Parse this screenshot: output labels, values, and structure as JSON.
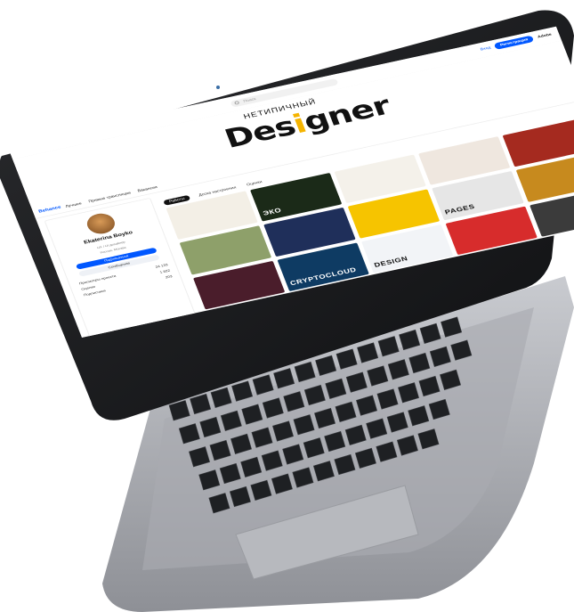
{
  "topbar": {
    "search_placeholder": "Поиск",
    "login": "Вход",
    "signup": "Регистрация",
    "adobe": "Adobe"
  },
  "banner": {
    "logo_small": "НЕТИПИЧНЫЙ",
    "logo_big_1": "Des",
    "logo_big_accent": "i",
    "logo_big_2": "gner"
  },
  "nav": {
    "brand": "Behance",
    "items": [
      "Лучшее",
      "Прямые трансляции",
      "Вакансии"
    ]
  },
  "profile": {
    "name": "Ekaterina Boyko",
    "subtitle": "UX / UI дизайнер",
    "location": "Россия, Москва",
    "follow": "Подписаться",
    "message": "Сообщение",
    "stats": [
      {
        "label": "Просмотры проекта",
        "value": "24 133"
      },
      {
        "label": "Оценки",
        "value": "1 822"
      },
      {
        "label": "Подписчики",
        "value": "203"
      }
    ]
  },
  "tabs": [
    "Работы",
    "Доска настроения",
    "Оценки"
  ],
  "tiles": [
    {
      "label": "",
      "color": "#f3efe6"
    },
    {
      "label": "ЭКО",
      "color": "#1b2a18"
    },
    {
      "label": "",
      "color": "#f4f1ea"
    },
    {
      "label": "",
      "color": "#efe7df"
    },
    {
      "label": "",
      "color": "#a52a1f"
    },
    {
      "label": "",
      "color": "#8ea06a"
    },
    {
      "label": "",
      "color": "#1f2f5a"
    },
    {
      "label": "",
      "color": "#f6c400"
    },
    {
      "label": "PAGES",
      "color": "#e6e6e6"
    },
    {
      "label": "",
      "color": "#c78a1e"
    },
    {
      "label": "",
      "color": "#4a1d2b"
    },
    {
      "label": "CRYPTOCLOUD",
      "color": "#0e3b63"
    },
    {
      "label": "DESIGN",
      "color": "#f2f4f7"
    },
    {
      "label": "",
      "color": "#d72c2c"
    },
    {
      "label": "",
      "color": "#3b3b3b"
    }
  ]
}
